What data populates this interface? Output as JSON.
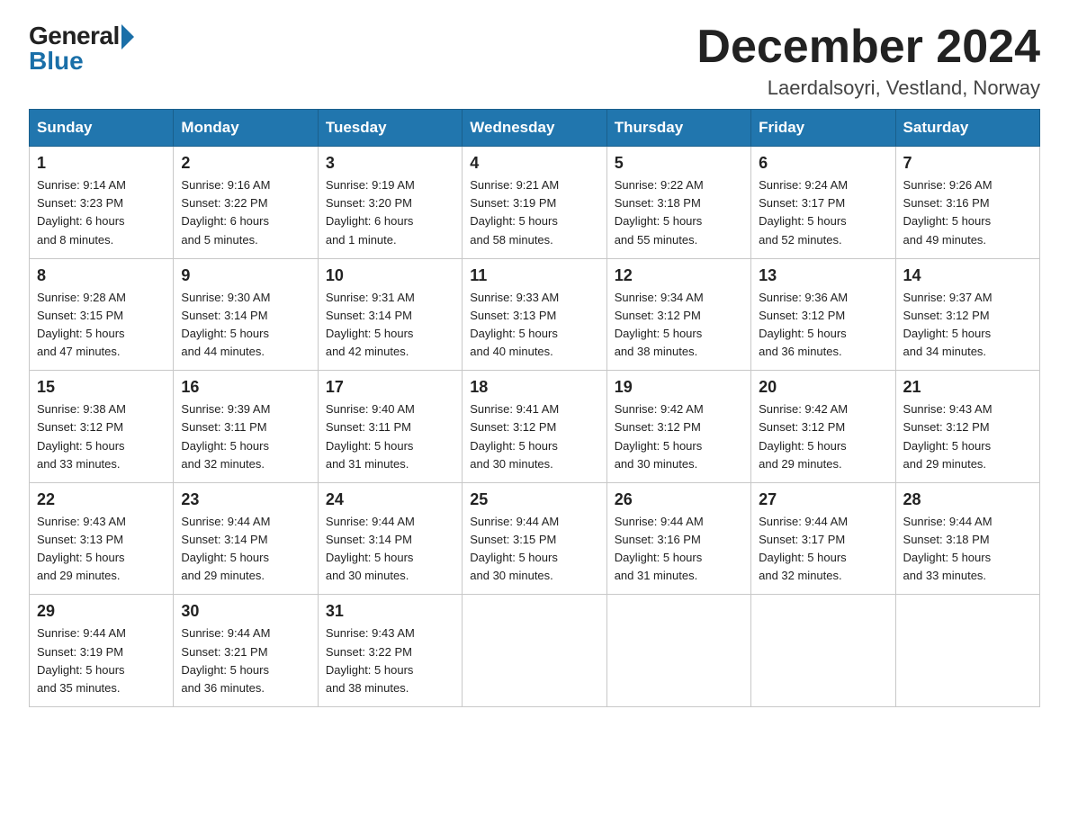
{
  "logo": {
    "general": "General",
    "blue": "Blue"
  },
  "title": "December 2024",
  "subtitle": "Laerdalsoyri, Vestland, Norway",
  "weekdays": [
    "Sunday",
    "Monday",
    "Tuesday",
    "Wednesday",
    "Thursday",
    "Friday",
    "Saturday"
  ],
  "weeks": [
    [
      {
        "date": "1",
        "sunrise": "9:14 AM",
        "sunset": "3:23 PM",
        "daylight": "6 hours and 8 minutes."
      },
      {
        "date": "2",
        "sunrise": "9:16 AM",
        "sunset": "3:22 PM",
        "daylight": "6 hours and 5 minutes."
      },
      {
        "date": "3",
        "sunrise": "9:19 AM",
        "sunset": "3:20 PM",
        "daylight": "6 hours and 1 minute."
      },
      {
        "date": "4",
        "sunrise": "9:21 AM",
        "sunset": "3:19 PM",
        "daylight": "5 hours and 58 minutes."
      },
      {
        "date": "5",
        "sunrise": "9:22 AM",
        "sunset": "3:18 PM",
        "daylight": "5 hours and 55 minutes."
      },
      {
        "date": "6",
        "sunrise": "9:24 AM",
        "sunset": "3:17 PM",
        "daylight": "5 hours and 52 minutes."
      },
      {
        "date": "7",
        "sunrise": "9:26 AM",
        "sunset": "3:16 PM",
        "daylight": "5 hours and 49 minutes."
      }
    ],
    [
      {
        "date": "8",
        "sunrise": "9:28 AM",
        "sunset": "3:15 PM",
        "daylight": "5 hours and 47 minutes."
      },
      {
        "date": "9",
        "sunrise": "9:30 AM",
        "sunset": "3:14 PM",
        "daylight": "5 hours and 44 minutes."
      },
      {
        "date": "10",
        "sunrise": "9:31 AM",
        "sunset": "3:14 PM",
        "daylight": "5 hours and 42 minutes."
      },
      {
        "date": "11",
        "sunrise": "9:33 AM",
        "sunset": "3:13 PM",
        "daylight": "5 hours and 40 minutes."
      },
      {
        "date": "12",
        "sunrise": "9:34 AM",
        "sunset": "3:12 PM",
        "daylight": "5 hours and 38 minutes."
      },
      {
        "date": "13",
        "sunrise": "9:36 AM",
        "sunset": "3:12 PM",
        "daylight": "5 hours and 36 minutes."
      },
      {
        "date": "14",
        "sunrise": "9:37 AM",
        "sunset": "3:12 PM",
        "daylight": "5 hours and 34 minutes."
      }
    ],
    [
      {
        "date": "15",
        "sunrise": "9:38 AM",
        "sunset": "3:12 PM",
        "daylight": "5 hours and 33 minutes."
      },
      {
        "date": "16",
        "sunrise": "9:39 AM",
        "sunset": "3:11 PM",
        "daylight": "5 hours and 32 minutes."
      },
      {
        "date": "17",
        "sunrise": "9:40 AM",
        "sunset": "3:11 PM",
        "daylight": "5 hours and 31 minutes."
      },
      {
        "date": "18",
        "sunrise": "9:41 AM",
        "sunset": "3:12 PM",
        "daylight": "5 hours and 30 minutes."
      },
      {
        "date": "19",
        "sunrise": "9:42 AM",
        "sunset": "3:12 PM",
        "daylight": "5 hours and 30 minutes."
      },
      {
        "date": "20",
        "sunrise": "9:42 AM",
        "sunset": "3:12 PM",
        "daylight": "5 hours and 29 minutes."
      },
      {
        "date": "21",
        "sunrise": "9:43 AM",
        "sunset": "3:12 PM",
        "daylight": "5 hours and 29 minutes."
      }
    ],
    [
      {
        "date": "22",
        "sunrise": "9:43 AM",
        "sunset": "3:13 PM",
        "daylight": "5 hours and 29 minutes."
      },
      {
        "date": "23",
        "sunrise": "9:44 AM",
        "sunset": "3:14 PM",
        "daylight": "5 hours and 29 minutes."
      },
      {
        "date": "24",
        "sunrise": "9:44 AM",
        "sunset": "3:14 PM",
        "daylight": "5 hours and 30 minutes."
      },
      {
        "date": "25",
        "sunrise": "9:44 AM",
        "sunset": "3:15 PM",
        "daylight": "5 hours and 30 minutes."
      },
      {
        "date": "26",
        "sunrise": "9:44 AM",
        "sunset": "3:16 PM",
        "daylight": "5 hours and 31 minutes."
      },
      {
        "date": "27",
        "sunrise": "9:44 AM",
        "sunset": "3:17 PM",
        "daylight": "5 hours and 32 minutes."
      },
      {
        "date": "28",
        "sunrise": "9:44 AM",
        "sunset": "3:18 PM",
        "daylight": "5 hours and 33 minutes."
      }
    ],
    [
      {
        "date": "29",
        "sunrise": "9:44 AM",
        "sunset": "3:19 PM",
        "daylight": "5 hours and 35 minutes."
      },
      {
        "date": "30",
        "sunrise": "9:44 AM",
        "sunset": "3:21 PM",
        "daylight": "5 hours and 36 minutes."
      },
      {
        "date": "31",
        "sunrise": "9:43 AM",
        "sunset": "3:22 PM",
        "daylight": "5 hours and 38 minutes."
      },
      null,
      null,
      null,
      null
    ]
  ],
  "labels": {
    "sunrise": "Sunrise:",
    "sunset": "Sunset:",
    "daylight": "Daylight:"
  }
}
